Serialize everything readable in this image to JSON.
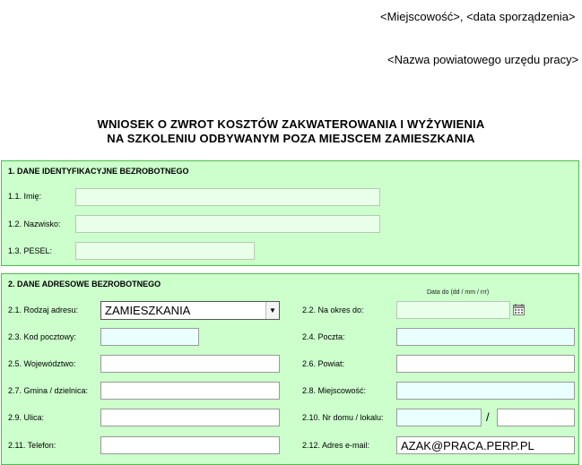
{
  "header": {
    "place_date": "<Miejscowość>,  <data sporządzenia>",
    "office_name": "<Nazwa  powiatowego urzędu pracy>"
  },
  "title": {
    "line1": "WNIOSEK O ZWROT KOSZTÓW ZAKWATEROWANIA  I WYŻYWIENIA",
    "line2": "NA SZKOLENIU ODBYWANYM POZA MIEJSCEM ZAMIESZKANIA"
  },
  "section1": {
    "title": "1. DANE IDENTYFIKACYJNE BEZROBOTNEGO",
    "imie_label": "1.1. Imię:",
    "imie_value": "",
    "nazwisko_label": "1.2. Nazwisko:",
    "nazwisko_value": "",
    "pesel_label": "1.3. PESEL:",
    "pesel_value": ""
  },
  "section2": {
    "title": "2. DANE ADRESOWE BEZROBOTNEGO",
    "rodzaj_label": "2.1. Rodzaj adresu:",
    "rodzaj_value": "ZAMIESZKANIA",
    "okres_label": "2.2. Na okres do:",
    "okres_hint": "Data do (dd / mm / rrr)",
    "okres_value": "",
    "kod_label": "2.3. Kod pocztowy:",
    "poczta_label": "2.4. Poczta:",
    "woj_label": "2.5. Województwo:",
    "powiat_label": "2.6. Powiat:",
    "gmina_label": "2.7. Gmina / dzielnica:",
    "miejscowosc_label": "2.8. Miejscowość:",
    "ulica_label": "2.9. Ulica:",
    "nr_label": "2.10. Nr domu / lokalu:",
    "nr_separator": "/",
    "telefon_label": "2.11. Telefon:",
    "email_label": "2.12. Adres e-mail:",
    "email_value": "AZAK@PRACA.PERP.PL"
  },
  "icons": {
    "calendar": "calendar-icon",
    "dropdown": "chevron-down-icon"
  }
}
